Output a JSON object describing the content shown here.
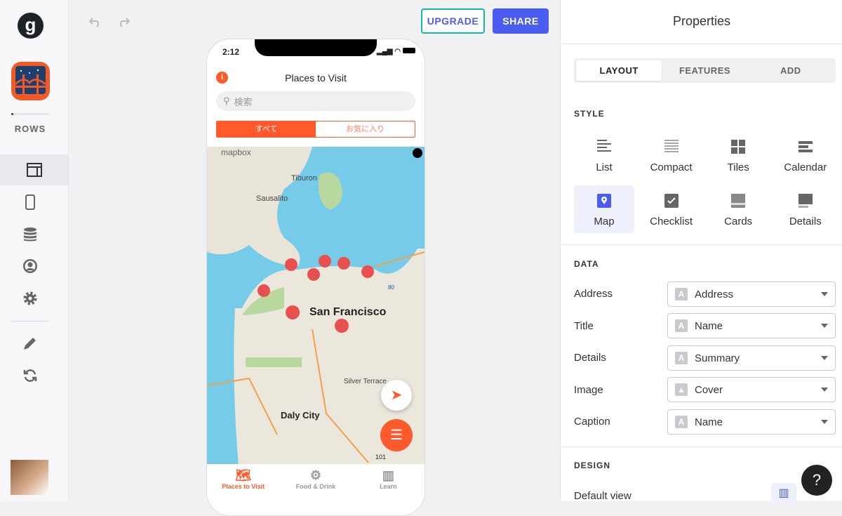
{
  "sidebar": {
    "section_label": "ROWS",
    "logo_letter": "g",
    "items": [
      {
        "icon": "layout-icon",
        "selected": true
      },
      {
        "icon": "phone-icon"
      },
      {
        "icon": "database-icon"
      },
      {
        "icon": "user-circle-icon"
      },
      {
        "icon": "gear-icon"
      },
      {
        "icon": "pencil-icon"
      },
      {
        "icon": "sync-icon"
      }
    ]
  },
  "toolbar": {
    "upgrade_label": "UPGRADE",
    "share_label": "SHARE",
    "accent": "#4b5cf0",
    "upgrade_color": "#14b8a6"
  },
  "phone": {
    "time": "2:12",
    "title": "Places to Visit",
    "search_placeholder": "検索",
    "segments": [
      "すべて",
      "お気に入り"
    ],
    "accent": "#ff5a2c",
    "map": {
      "attribution": "mapbox",
      "labels": {
        "tiburon": "Tiburon",
        "sausalito": "Sausalito",
        "sf": "San Francisco",
        "silver": "Silver Terrace",
        "daly": "Daly City",
        "hwy101": "101",
        "hwy80": "80"
      }
    },
    "tabs": [
      {
        "label": "Places to Visit",
        "active": true
      },
      {
        "label": "Food & Drink"
      },
      {
        "label": "Learn"
      }
    ]
  },
  "panel": {
    "title": "Properties",
    "tabs": [
      "LAYOUT",
      "FEATURES",
      "ADD"
    ],
    "style_heading": "STYLE",
    "styles": [
      {
        "label": "List"
      },
      {
        "label": "Compact"
      },
      {
        "label": "Tiles"
      },
      {
        "label": "Calendar"
      },
      {
        "label": "Map",
        "selected": true
      },
      {
        "label": "Checklist"
      },
      {
        "label": "Cards"
      },
      {
        "label": "Details"
      }
    ],
    "data_heading": "DATA",
    "data_rows": [
      {
        "label": "Address",
        "value": "Address",
        "type": "text"
      },
      {
        "label": "Title",
        "value": "Name",
        "type": "text"
      },
      {
        "label": "Details",
        "value": "Summary",
        "type": "text"
      },
      {
        "label": "Image",
        "value": "Cover",
        "type": "image"
      },
      {
        "label": "Caption",
        "value": "Name",
        "type": "text"
      }
    ],
    "text_type_badge": "A",
    "design_heading": "DESIGN",
    "default_view_label": "Default view",
    "help_label": "?"
  }
}
